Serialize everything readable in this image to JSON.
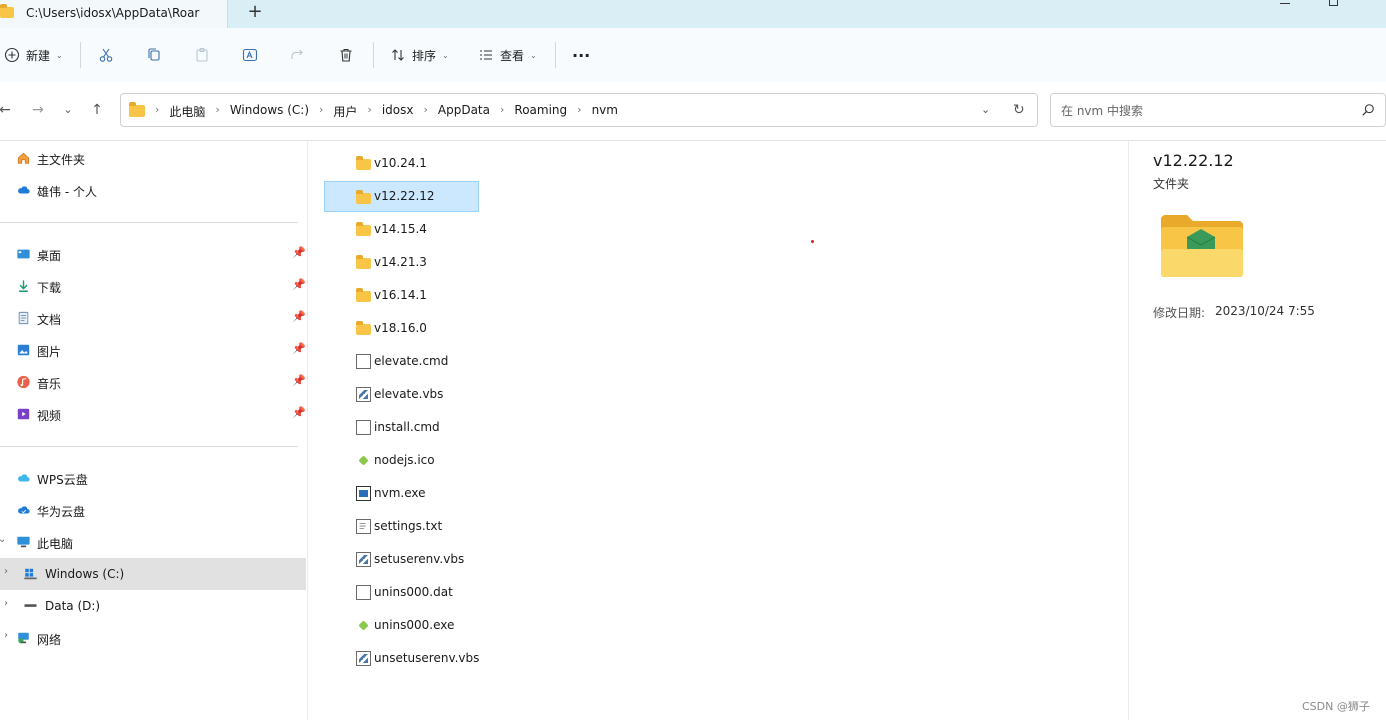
{
  "window": {
    "tab_title": "C:\\Users\\idosx\\AppData\\Roar",
    "new_tab_label": "+"
  },
  "toolbar": {
    "new_label": "新建",
    "sort_label": "排序",
    "view_label": "查看",
    "more_label": "···"
  },
  "address": {
    "crumbs": [
      "此电脑",
      "Windows (C:)",
      "用户",
      "idosx",
      "AppData",
      "Roaming",
      "nvm"
    ],
    "separator": "›"
  },
  "search": {
    "placeholder": "在 nvm 中搜索"
  },
  "sidebar": {
    "items": [
      {
        "label": "主文件夹",
        "icon": "home-icon"
      },
      {
        "label": "雄伟 - 个人",
        "icon": "onedrive-cloud-icon"
      },
      {
        "label": "桌面",
        "icon": "desktop-icon"
      },
      {
        "label": "下载",
        "icon": "download-icon"
      },
      {
        "label": "文档",
        "icon": "document-icon"
      },
      {
        "label": "图片",
        "icon": "pictures-icon"
      },
      {
        "label": "音乐",
        "icon": "music-icon"
      },
      {
        "label": "视频",
        "icon": "video-icon"
      },
      {
        "label": "WPS云盘",
        "icon": "wps-cloud-icon"
      },
      {
        "label": "华为云盘",
        "icon": "huawei-cloud-icon"
      },
      {
        "label": "此电脑",
        "icon": "computer-icon"
      },
      {
        "label": "Windows (C:)",
        "icon": "windows-drive-icon"
      },
      {
        "label": "Data (D:)",
        "icon": "drive-icon"
      },
      {
        "label": "网络",
        "icon": "network-icon"
      }
    ],
    "pin_glyph": "📌"
  },
  "files": [
    {
      "name": "v10.24.1",
      "kind": "folder"
    },
    {
      "name": "v12.22.12",
      "kind": "folder"
    },
    {
      "name": "v14.15.4",
      "kind": "folder"
    },
    {
      "name": "v14.21.3",
      "kind": "folder"
    },
    {
      "name": "v16.14.1",
      "kind": "folder"
    },
    {
      "name": "v18.16.0",
      "kind": "folder"
    },
    {
      "name": "elevate.cmd",
      "kind": "cmd"
    },
    {
      "name": "elevate.vbs",
      "kind": "vbs"
    },
    {
      "name": "install.cmd",
      "kind": "cmd"
    },
    {
      "name": "nodejs.ico",
      "kind": "node"
    },
    {
      "name": "nvm.exe",
      "kind": "exe"
    },
    {
      "name": "settings.txt",
      "kind": "txt"
    },
    {
      "name": "setuserenv.vbs",
      "kind": "vbs"
    },
    {
      "name": "unins000.dat",
      "kind": "dat"
    },
    {
      "name": "unins000.exe",
      "kind": "node"
    },
    {
      "name": "unsetuserenv.vbs",
      "kind": "vbs"
    }
  ],
  "details": {
    "name": "v12.22.12",
    "type": "文件夹",
    "modified_label": "修改日期:",
    "modified_value": "2023/10/24 7:55"
  },
  "watermark": "CSDN @狮子",
  "colors": {
    "selection": "#cce8ff",
    "folder": "#f8c547",
    "sidebar_selected": "#e1e1e1"
  }
}
